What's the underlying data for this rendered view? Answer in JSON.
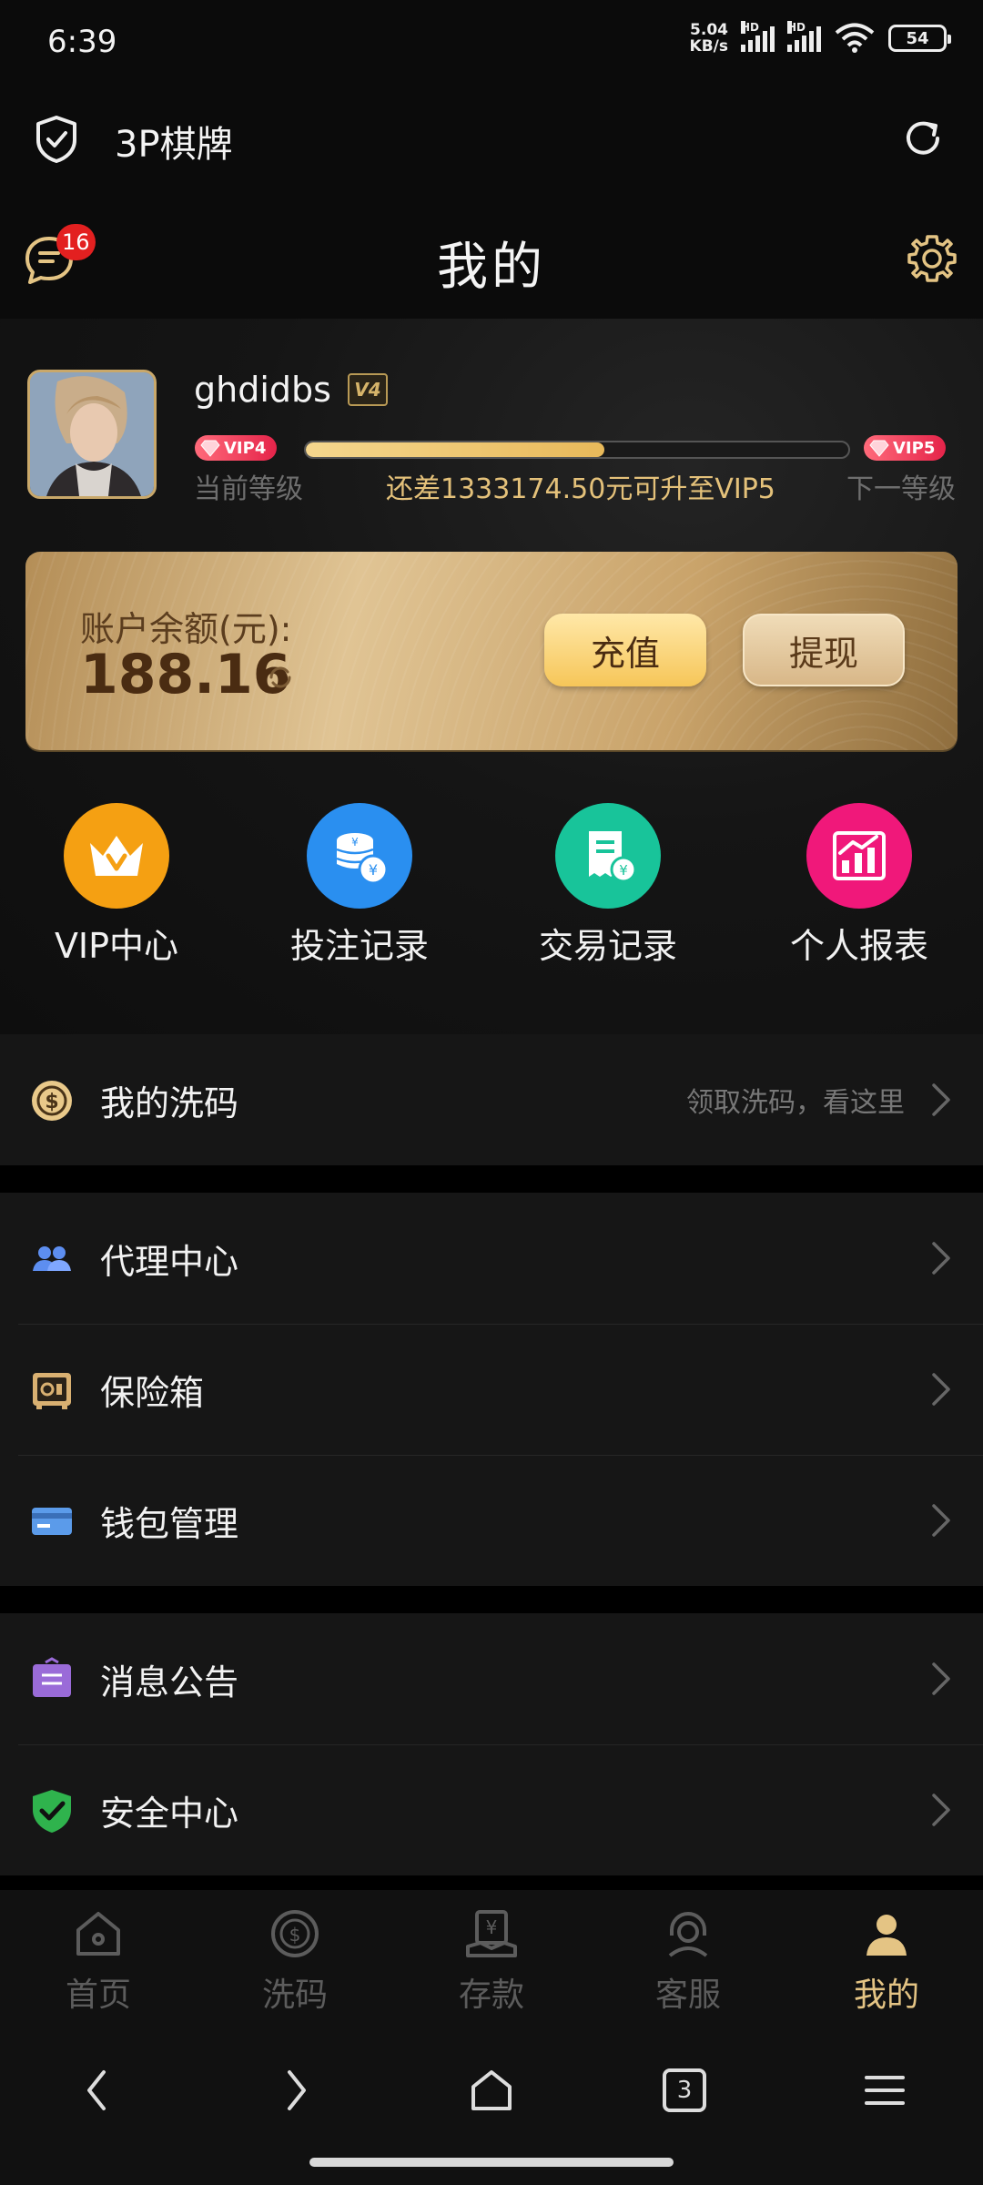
{
  "status": {
    "time": "6:39",
    "net_speed": "5.04",
    "net_unit": "KB/s",
    "battery": "54",
    "hd": "HD",
    "sim2": "6"
  },
  "app": {
    "title": "3P棋牌"
  },
  "header": {
    "title": "我的",
    "message_count": "16"
  },
  "profile": {
    "username": "ghdidbs",
    "level_badge": "V4",
    "current_vip": "VIP4",
    "next_vip": "VIP5",
    "progress_fraction": 0.55,
    "current_level_label": "当前等级",
    "next_level_label": "下一等级",
    "upgrade_message": "还差1333174.50元可升至VIP5"
  },
  "balance": {
    "label": "账户余额(元):",
    "value": "188.16",
    "recharge": "充值",
    "withdraw": "提现"
  },
  "quick_actions": [
    {
      "label": "VIP中心",
      "icon": "vip-crown-icon",
      "color": "#f5a012"
    },
    {
      "label": "投注记录",
      "icon": "coins-icon",
      "color": "#2a8ff0"
    },
    {
      "label": "交易记录",
      "icon": "receipt-icon",
      "color": "#18c49a"
    },
    {
      "label": "个人报表",
      "icon": "chart-icon",
      "color": "#f0187a"
    }
  ],
  "menu": {
    "wash": {
      "label": "我的洗码",
      "hint": "领取洗码，看这里"
    },
    "agent": {
      "label": "代理中心"
    },
    "safe": {
      "label": "保险箱"
    },
    "wallet": {
      "label": "钱包管理"
    },
    "notice": {
      "label": "消息公告"
    },
    "security": {
      "label": "安全中心"
    }
  },
  "tabs": [
    {
      "label": "首页",
      "icon": "home-icon"
    },
    {
      "label": "洗码",
      "icon": "wash-coin-icon"
    },
    {
      "label": "存款",
      "icon": "deposit-icon"
    },
    {
      "label": "客服",
      "icon": "support-icon"
    },
    {
      "label": "我的",
      "icon": "user-icon",
      "active": true
    }
  ],
  "system_nav": {
    "tabs_count": "3"
  },
  "colors": {
    "gold": "#e4c484",
    "badge_red": "#e32020",
    "background": "#0b0b0b"
  }
}
